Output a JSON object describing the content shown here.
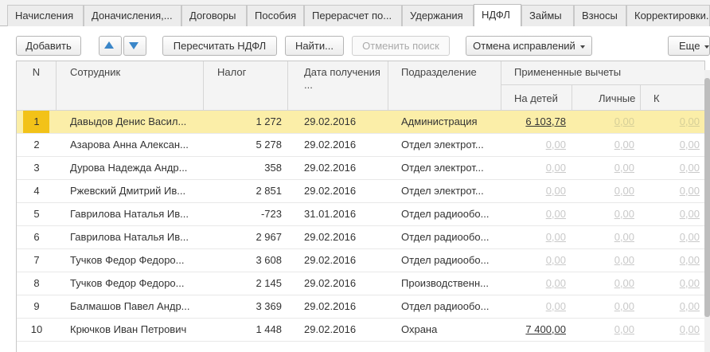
{
  "tabs": [
    {
      "label": "Начисления",
      "active": false
    },
    {
      "label": "Доначисления,...",
      "active": false
    },
    {
      "label": "Договоры",
      "active": false
    },
    {
      "label": "Пособия",
      "active": false
    },
    {
      "label": "Перерасчет по...",
      "active": false
    },
    {
      "label": "Удержания",
      "active": false
    },
    {
      "label": "НДФЛ",
      "active": true
    },
    {
      "label": "Займы",
      "active": false
    },
    {
      "label": "Взносы",
      "active": false
    },
    {
      "label": "Корректировки...",
      "active": false
    }
  ],
  "toolbar": {
    "add_label": "Добавить",
    "recalc_label": "Пересчитать НДФЛ",
    "find_label": "Найти...",
    "cancel_search_label": "Отменить поиск",
    "cancel_fix_label": "Отмена исправлений",
    "more_label": "Еще"
  },
  "table": {
    "headers": {
      "n": "N",
      "employee": "Сотрудник",
      "tax": "Налог",
      "date": "Дата получения ...",
      "division": "Подразделение",
      "deductions": "Примененные вычеты",
      "children": "На детей",
      "personal": "Личные",
      "k": "К"
    },
    "rows": [
      {
        "n": "1",
        "employee": "Давыдов Денис Васил...",
        "tax": "1 272",
        "date": "29.02.2016",
        "division": "Администрация",
        "children": "6 103,78",
        "personal": "0,00",
        "k": "0,00",
        "selected": true
      },
      {
        "n": "2",
        "employee": "Азарова Анна Алексан...",
        "tax": "5 278",
        "date": "29.02.2016",
        "division": "Отдел электрот...",
        "children": "0,00",
        "personal": "0,00",
        "k": "0,00",
        "selected": false
      },
      {
        "n": "3",
        "employee": "Дурова Надежда Андр...",
        "tax": "358",
        "date": "29.02.2016",
        "division": "Отдел электрот...",
        "children": "0,00",
        "personal": "0,00",
        "k": "0,00",
        "selected": false
      },
      {
        "n": "4",
        "employee": "Ржевский Дмитрий Ив...",
        "tax": "2 851",
        "date": "29.02.2016",
        "division": "Отдел электрот...",
        "children": "0,00",
        "personal": "0,00",
        "k": "0,00",
        "selected": false
      },
      {
        "n": "5",
        "employee": "Гаврилова Наталья Ив...",
        "tax": "-723",
        "date": "31.01.2016",
        "division": "Отдел радиообо...",
        "children": "0,00",
        "personal": "0,00",
        "k": "0,00",
        "selected": false
      },
      {
        "n": "6",
        "employee": "Гаврилова Наталья Ив...",
        "tax": "2 967",
        "date": "29.02.2016",
        "division": "Отдел радиообо...",
        "children": "0,00",
        "personal": "0,00",
        "k": "0,00",
        "selected": false
      },
      {
        "n": "7",
        "employee": "Тучков Федор Федоро...",
        "tax": "3 608",
        "date": "29.02.2016",
        "division": "Отдел радиообо...",
        "children": "0,00",
        "personal": "0,00",
        "k": "0,00",
        "selected": false
      },
      {
        "n": "8",
        "employee": "Тучков Федор Федоро...",
        "tax": "2 145",
        "date": "29.02.2016",
        "division": "Производственн...",
        "children": "0,00",
        "personal": "0,00",
        "k": "0,00",
        "selected": false
      },
      {
        "n": "9",
        "employee": "Балмашов Павел Андр...",
        "tax": "3 369",
        "date": "29.02.2016",
        "division": "Отдел радиообо...",
        "children": "0,00",
        "personal": "0,00",
        "k": "0,00",
        "selected": false
      },
      {
        "n": "10",
        "employee": "Крючков Иван Петрович",
        "tax": "1 448",
        "date": "29.02.2016",
        "division": "Охрана",
        "children": "7 400,00",
        "personal": "0,00",
        "k": "0,00",
        "selected": false
      }
    ]
  }
}
